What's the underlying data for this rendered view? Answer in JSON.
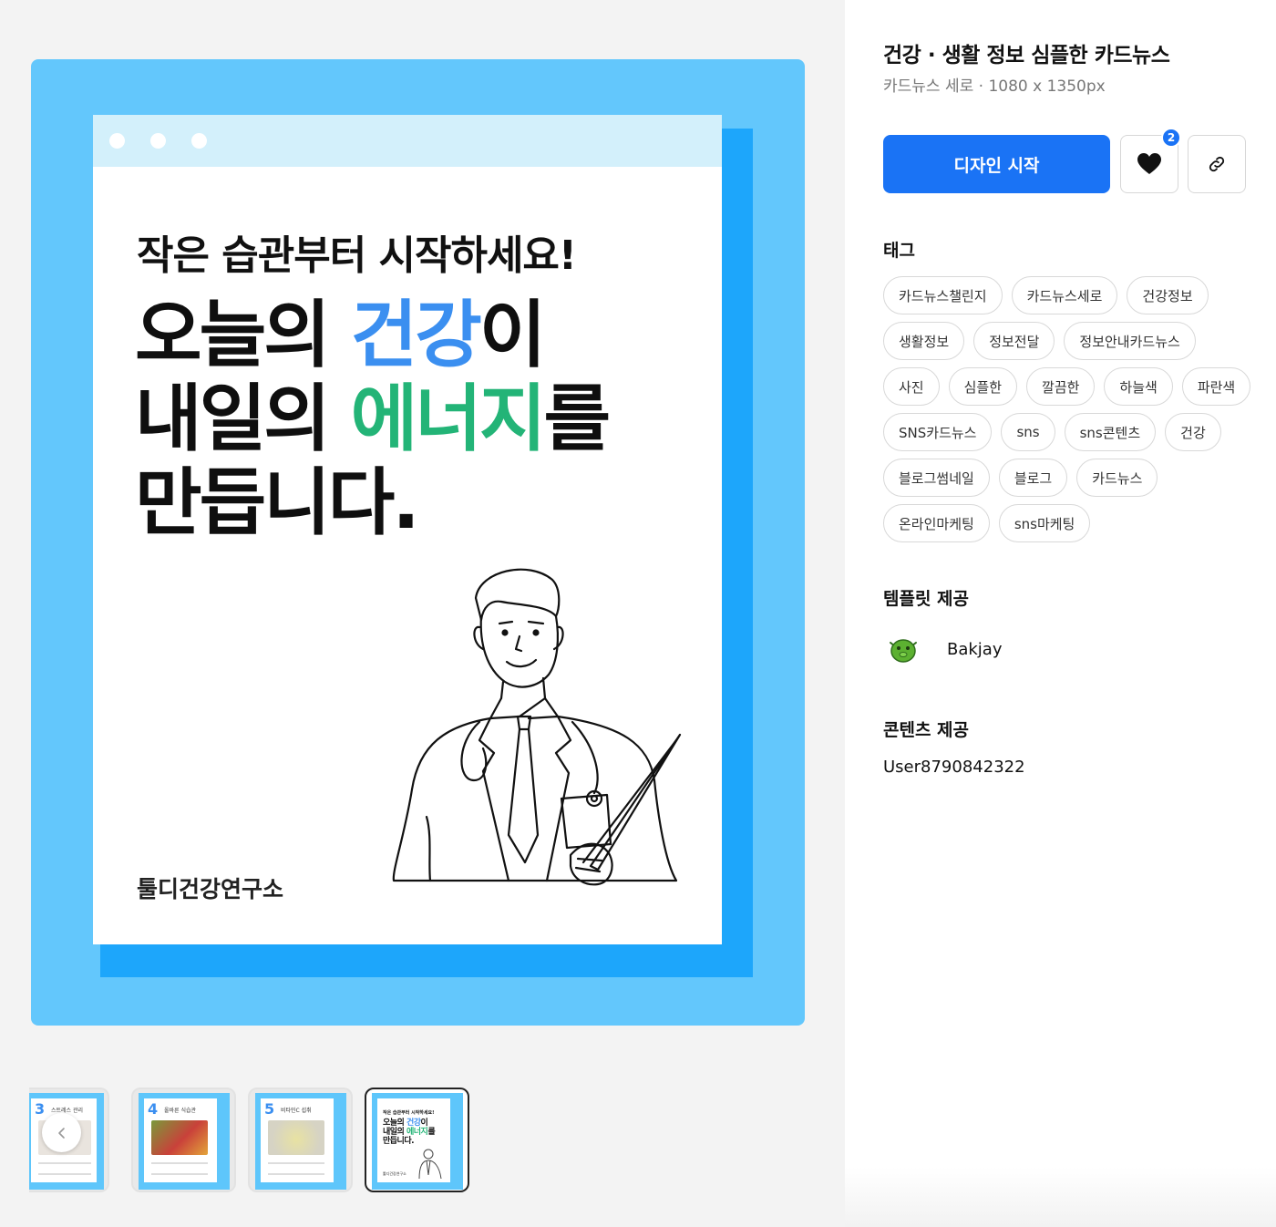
{
  "preview": {
    "card_subtitle": "작은 습관부터 시작하세요!",
    "headline": {
      "line1_pre": "오늘의 ",
      "line1_highlight": "건강",
      "line1_post": "이",
      "line2_pre": "내일의 ",
      "line2_highlight": "에너지",
      "line2_post": "를",
      "line3": "만듭니다."
    },
    "brand": "툴디건강연구소",
    "colors": {
      "frame": "#63c7fc",
      "shadow": "#1da6fb",
      "highlight_blue": "#3b8ff0",
      "highlight_green": "#23b477"
    }
  },
  "thumbnails": [
    {
      "number": "3",
      "title": "스트레스 관리"
    },
    {
      "number": "4",
      "title": "올바른 식습관"
    },
    {
      "number": "5",
      "title": "비타민C 섭취"
    },
    {
      "sub": "작은 습관부터 시작하세요!",
      "head1": "오늘의 ",
      "head1_hl": "건강",
      "head1_post": "이",
      "head2": "내일의 ",
      "head2_hl": "에너지",
      "head2_post": "를",
      "head3": "만듭니다.",
      "brand": "툴디건강연구소",
      "active": true
    }
  ],
  "panel": {
    "title": "건강 · 생활 정보 심플한 카드뉴스",
    "subtitle": "카드뉴스 세로 · 1080 x 1350px",
    "start_button": "디자인 시작",
    "like_count": "2",
    "tags_heading": "태그",
    "tags": [
      [
        "카드뉴스챌린지",
        "카드뉴스세로",
        "건강정보"
      ],
      [
        "생활정보",
        "정보전달",
        "정보안내카드뉴스"
      ],
      [
        "사진",
        "심플한",
        "깔끔한",
        "하늘색",
        "파란색"
      ],
      [
        "SNS카드뉴스",
        "sns",
        "sns콘텐츠",
        "건강"
      ],
      [
        "블로그썸네일",
        "블로그",
        "카드뉴스"
      ],
      [
        "온라인마케팅",
        "sns마케팅"
      ]
    ],
    "template_heading": "템플릿 제공",
    "template_author": "Bakjay",
    "content_heading": "콘텐츠 제공",
    "content_user": "User8790842322"
  },
  "icons": [
    "heart-icon",
    "link-icon",
    "chevron-left-icon",
    "avatar-icon"
  ]
}
